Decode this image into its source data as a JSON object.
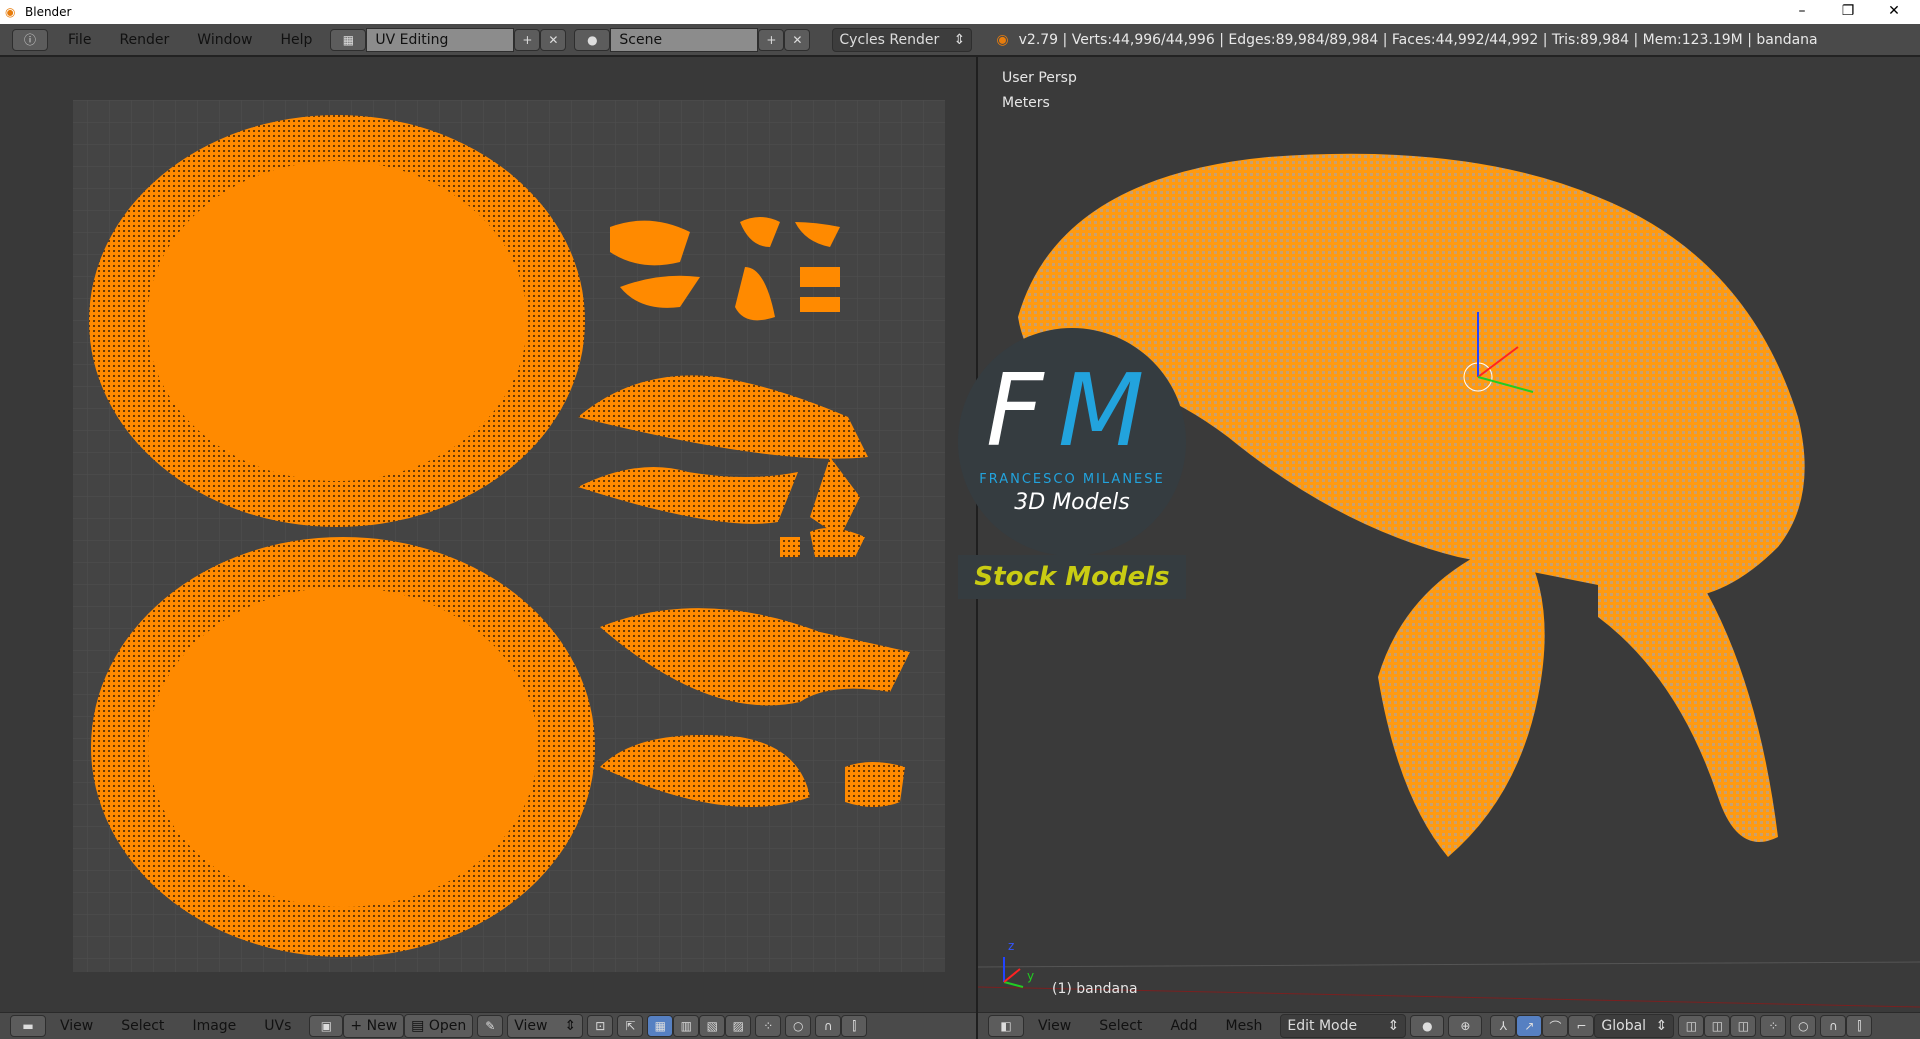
{
  "window": {
    "title": "Blender",
    "minimize": "–",
    "restore": "❐",
    "close": "✕"
  },
  "top_header": {
    "menus": [
      "File",
      "Render",
      "Window",
      "Help"
    ],
    "layout": "UV Editing",
    "scene": "Scene",
    "engine": "Cycles Render",
    "stats": "v2.79 | Verts:44,996/44,996 | Edges:89,984/89,984 | Faces:44,992/44,992 | Tris:89,984 | Mem:123.19M | bandana"
  },
  "uv_editor": {
    "menus": [
      "View",
      "Select",
      "Image",
      "UVs"
    ],
    "new_label": "New",
    "open_label": "Open",
    "view_label": "View"
  },
  "viewport": {
    "view_name": "User Persp",
    "units": "Meters",
    "object_label": "(1) bandana",
    "axis_z": "z",
    "axis_y": "y",
    "menus": [
      "View",
      "Select",
      "Add",
      "Mesh"
    ],
    "mode": "Edit Mode",
    "orientation": "Global"
  },
  "watermark": {
    "letters_f": "F",
    "letters_m": "M",
    "name": "FRANCESCO MILANESE",
    "sub": "3D Models",
    "badge": "Stock Models"
  },
  "colors": {
    "mesh": "#ff8a00",
    "accent": "#5680c2",
    "brand_blue": "#22a3dd",
    "brand_yellow": "#c9cc13"
  }
}
